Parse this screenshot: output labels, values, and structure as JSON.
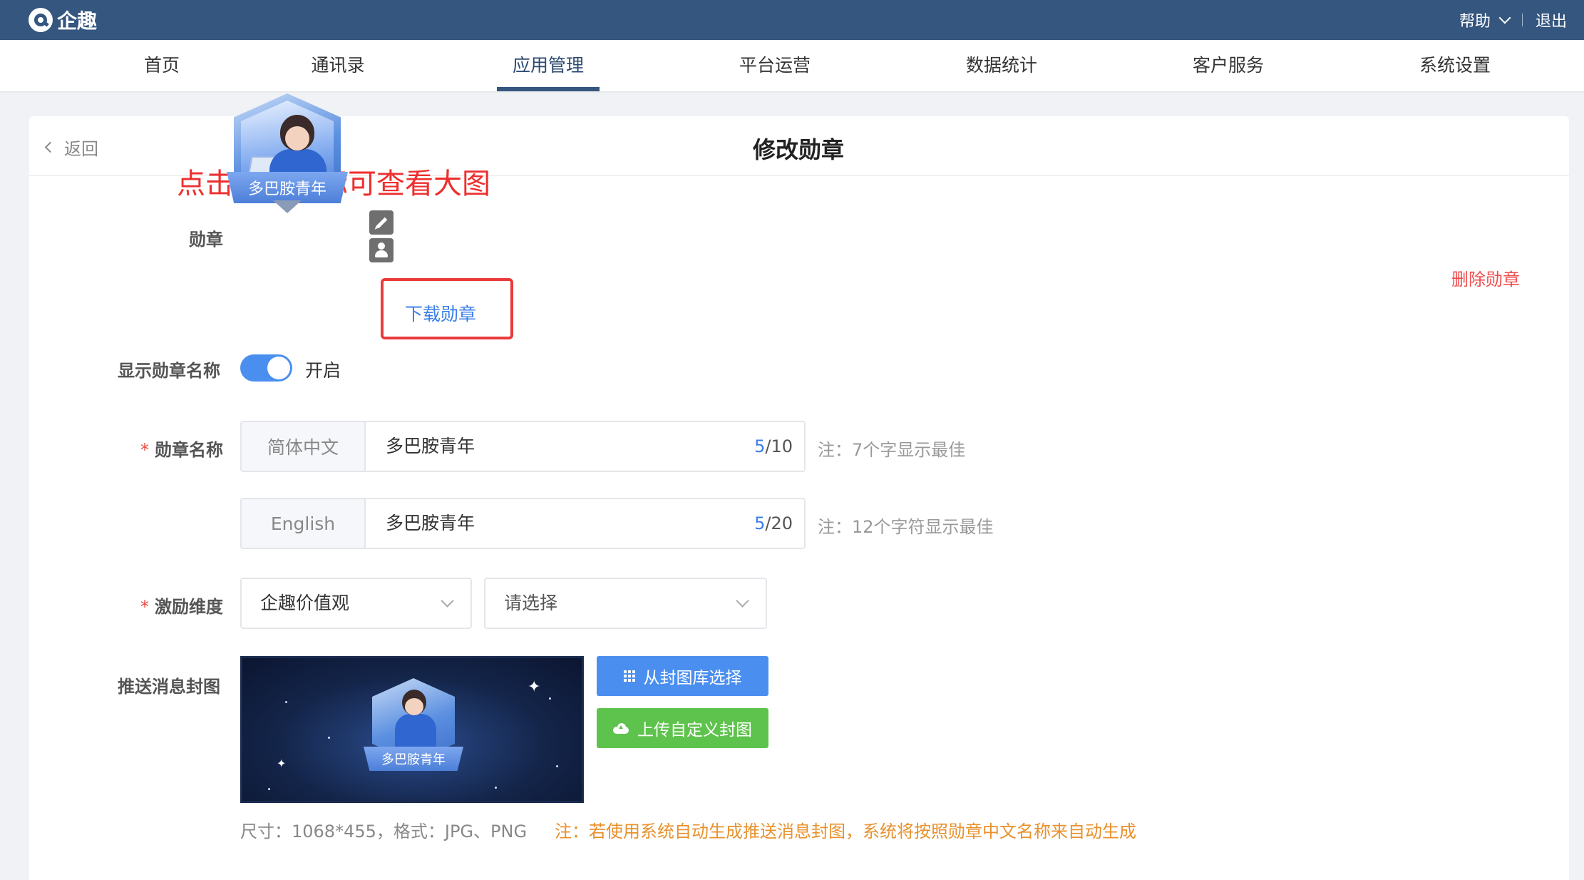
{
  "app": {
    "name": "企趣"
  },
  "topbar": {
    "help": "帮助",
    "logout": "退出"
  },
  "nav": {
    "items": [
      {
        "label": "首页"
      },
      {
        "label": "通讯录"
      },
      {
        "label": "应用管理",
        "active": true
      },
      {
        "label": "平台运营"
      },
      {
        "label": "数据统计"
      },
      {
        "label": "客户服务"
      },
      {
        "label": "系统设置"
      }
    ]
  },
  "page": {
    "back": "返回",
    "title": "修改勋章",
    "hint": "点击勋章图标可查看大图"
  },
  "badge": {
    "label": "勋章",
    "name_on_badge": "多巴胺青年",
    "download": "下载勋章",
    "delete": "删除勋章",
    "edit_icon": "pencil-icon",
    "profile_icon": "user-badge-icon"
  },
  "show_name": {
    "label": "显示勋章名称",
    "state": "开启",
    "enabled": true
  },
  "badge_name": {
    "required_mark": "*",
    "label": "勋章名称",
    "zh": {
      "lang": "简体中文",
      "value": "多巴胺青年",
      "count": "5",
      "max": "/10",
      "note": "注：7个字显示最佳"
    },
    "en": {
      "lang": "English",
      "value": "多巴胺青年",
      "count": "5",
      "max": "/20",
      "note": "注：12个字符显示最佳"
    }
  },
  "dimension": {
    "required_mark": "*",
    "label": "激励维度",
    "primary": "企趣价值观",
    "secondary": "请选择"
  },
  "cover": {
    "label": "推送消息封图",
    "badge_text": "多巴胺青年",
    "choose_button": "从封图库选择",
    "upload_button": "上传自定义封图",
    "size_note": "尺寸：1068*455，格式：JPG、PNG",
    "auto_note": "注：若使用系统自动生成推送消息封图，系统将按照勋章中文名称来自动生成"
  },
  "colors": {
    "topbar": "#34567f",
    "primary": "#4a8ff0",
    "success": "#5ec34c",
    "danger": "#ef4b4b",
    "warning": "#e8912c",
    "hint_red": "#ee2e2e"
  }
}
